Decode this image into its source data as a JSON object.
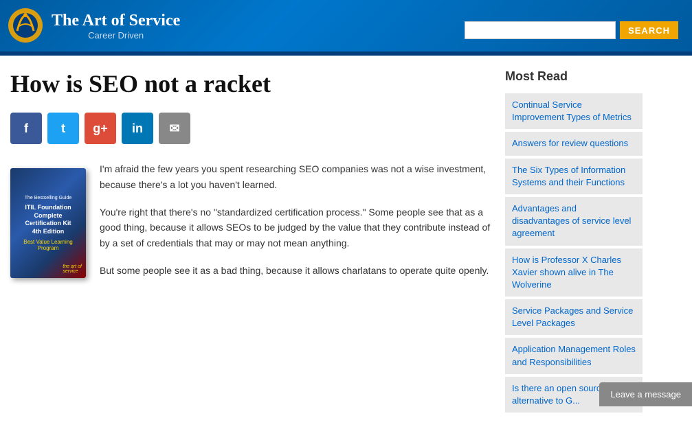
{
  "header": {
    "logo_title": "The Art of Service",
    "logo_subtitle": "Career Driven",
    "search_placeholder": "",
    "search_button_label": "SEARCH"
  },
  "article": {
    "title": "How is SEO not a racket",
    "paragraph1": "I'm afraid the few years you spent researching SEO companies was not a wise investment, because there's a lot you haven't learned.",
    "paragraph2": "You're right that there's no \"standardized certification process.\" Some people see that as a good thing, because it allows SEOs to be judged by the value that they contribute instead of by a set of credentials that may or may not mean anything.",
    "paragraph3": "But some people see it as a bad thing, because it allows charlatans to operate quite openly."
  },
  "social_icons": [
    {
      "name": "facebook",
      "label": "f",
      "class": "social-fb"
    },
    {
      "name": "twitter",
      "label": "t",
      "class": "social-tw"
    },
    {
      "name": "google-plus",
      "label": "g+",
      "class": "social-gp"
    },
    {
      "name": "linkedin",
      "label": "in",
      "class": "social-li"
    },
    {
      "name": "email",
      "label": "✉",
      "class": "social-em"
    }
  ],
  "book": {
    "label_top": "The Bestselling Guide",
    "label_main": "ITIL Foundation\nComplete Certification Kit\n4th Edition",
    "label_sub": "Best Value Learning Program",
    "logo_bottom": "the art of\nservice"
  },
  "sidebar": {
    "title": "Most Read",
    "items": [
      {
        "text": "Continual Service Improvement Types of Metrics"
      },
      {
        "text": "Answers for review questions"
      },
      {
        "text": "The Six Types of Information Systems and their Functions"
      },
      {
        "text": "Advantages and disadvantages of service level agreement"
      },
      {
        "text": "How is Professor X Charles Xavier shown alive in The Wolverine"
      },
      {
        "text": "Service Packages and Service Level Packages"
      },
      {
        "text": "Application Management Roles and Responsibilities"
      },
      {
        "text": "Is there an open source alternative to G..."
      }
    ]
  },
  "leave_message": {
    "label": "Leave a message"
  }
}
